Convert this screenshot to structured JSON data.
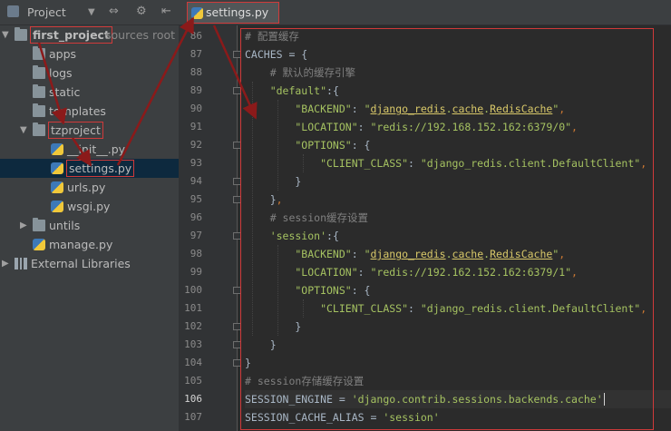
{
  "project_panel": {
    "title": "Project",
    "controls": [
      "⇔",
      "⚙",
      "⇤"
    ]
  },
  "tree": [
    {
      "label": "first_project",
      "suffix": "sources root",
      "type": "folder",
      "expanded": true,
      "highlight": true,
      "level": 0
    },
    {
      "label": "apps",
      "type": "folder",
      "level": 1
    },
    {
      "label": "logs",
      "type": "folder",
      "level": 1
    },
    {
      "label": "static",
      "type": "folder",
      "level": 1
    },
    {
      "label": "templates",
      "type": "folder",
      "level": 1
    },
    {
      "label": "tzproject",
      "type": "folder",
      "expanded": true,
      "highlight": true,
      "level": 1
    },
    {
      "label": "__init__.py",
      "type": "py",
      "level": 2
    },
    {
      "label": "settings.py",
      "type": "py",
      "level": 2,
      "selected": true,
      "highlight": true
    },
    {
      "label": "urls.py",
      "type": "py",
      "level": 2
    },
    {
      "label": "wsgi.py",
      "type": "py",
      "level": 2
    },
    {
      "label": "untils",
      "type": "folder",
      "collapsed": true,
      "level": 1
    },
    {
      "label": "manage.py",
      "type": "py",
      "level": 1
    },
    {
      "label": "External Libraries",
      "type": "lib",
      "collapsed": true,
      "level": 0
    }
  ],
  "tab": {
    "label": "settings.py"
  },
  "code": [
    {
      "n": "86",
      "tokens": [
        [
          "com",
          "# 配置缓存"
        ]
      ]
    },
    {
      "n": "87",
      "tokens": [
        [
          "plain",
          "CACHES = {"
        ]
      ]
    },
    {
      "n": "88",
      "tokens": [
        [
          "com",
          "    # 默认的缓存引擎"
        ]
      ]
    },
    {
      "n": "89",
      "tokens": [
        [
          "str",
          "    \"default\""
        ],
        [
          "plain",
          ":{"
        ]
      ]
    },
    {
      "n": "90",
      "tokens": [
        [
          "str",
          "        \"BACKEND\""
        ],
        [
          "plain",
          ": "
        ],
        [
          "str",
          "\""
        ],
        [
          "link",
          "django_redis"
        ],
        [
          "str",
          "."
        ],
        [
          "link",
          "cache"
        ],
        [
          "str",
          "."
        ],
        [
          "link",
          "RedisCache"
        ],
        [
          "str",
          "\""
        ],
        [
          "key",
          ","
        ]
      ]
    },
    {
      "n": "91",
      "tokens": [
        [
          "str",
          "        \"LOCATION\""
        ],
        [
          "plain",
          ": "
        ],
        [
          "str",
          "\"redis://192.168.152.162:6379/0\""
        ],
        [
          "key",
          ","
        ]
      ]
    },
    {
      "n": "92",
      "tokens": [
        [
          "str",
          "        \"OPTIONS\""
        ],
        [
          "plain",
          ": {"
        ]
      ]
    },
    {
      "n": "93",
      "tokens": [
        [
          "str",
          "            \"CLIENT_CLASS\""
        ],
        [
          "plain",
          ": "
        ],
        [
          "str",
          "\"django_redis.client.DefaultClient\""
        ],
        [
          "key",
          ","
        ]
      ]
    },
    {
      "n": "94",
      "tokens": [
        [
          "plain",
          "        }"
        ]
      ]
    },
    {
      "n": "95",
      "tokens": [
        [
          "plain",
          "    }"
        ],
        [
          "key",
          ","
        ]
      ]
    },
    {
      "n": "96",
      "tokens": [
        [
          "com",
          "    # session缓存设置"
        ]
      ]
    },
    {
      "n": "97",
      "tokens": [
        [
          "str",
          "    'session'"
        ],
        [
          "plain",
          ":{"
        ]
      ]
    },
    {
      "n": "98",
      "tokens": [
        [
          "str",
          "        \"BACKEND\""
        ],
        [
          "plain",
          ": "
        ],
        [
          "str",
          "\""
        ],
        [
          "link",
          "django_redis"
        ],
        [
          "str",
          "."
        ],
        [
          "link",
          "cache"
        ],
        [
          "str",
          "."
        ],
        [
          "link",
          "RedisCache"
        ],
        [
          "str",
          "\""
        ],
        [
          "key",
          ","
        ]
      ]
    },
    {
      "n": "99",
      "tokens": [
        [
          "str",
          "        \"LOCATION\""
        ],
        [
          "plain",
          ": "
        ],
        [
          "str",
          "\"redis://192.162.152.162:6379/1\""
        ],
        [
          "key",
          ","
        ]
      ]
    },
    {
      "n": "100",
      "tokens": [
        [
          "str",
          "        \"OPTIONS\""
        ],
        [
          "plain",
          ": {"
        ]
      ]
    },
    {
      "n": "101",
      "tokens": [
        [
          "str",
          "            \"CLIENT_CLASS\""
        ],
        [
          "plain",
          ": "
        ],
        [
          "str",
          "\"django_redis.client.DefaultClient\""
        ],
        [
          "key",
          ","
        ]
      ]
    },
    {
      "n": "102",
      "tokens": [
        [
          "plain",
          "        }"
        ]
      ]
    },
    {
      "n": "103",
      "tokens": [
        [
          "plain",
          "    }"
        ]
      ]
    },
    {
      "n": "104",
      "tokens": [
        [
          "plain",
          "}"
        ]
      ]
    },
    {
      "n": "105",
      "tokens": [
        [
          "com",
          "# session存储缓存设置"
        ]
      ]
    },
    {
      "n": "106",
      "current": true,
      "tokens": [
        [
          "plain",
          "SESSION_ENGINE = "
        ],
        [
          "str",
          "'django.contrib.sessions.backends.cache'"
        ]
      ]
    },
    {
      "n": "107",
      "tokens": [
        [
          "plain",
          "SESSION_CACHE_ALIAS = "
        ],
        [
          "str",
          "'session'"
        ]
      ]
    }
  ],
  "colors": {
    "annotation": "#d03a3a",
    "annotation_arrow": "#8b1a1a"
  }
}
